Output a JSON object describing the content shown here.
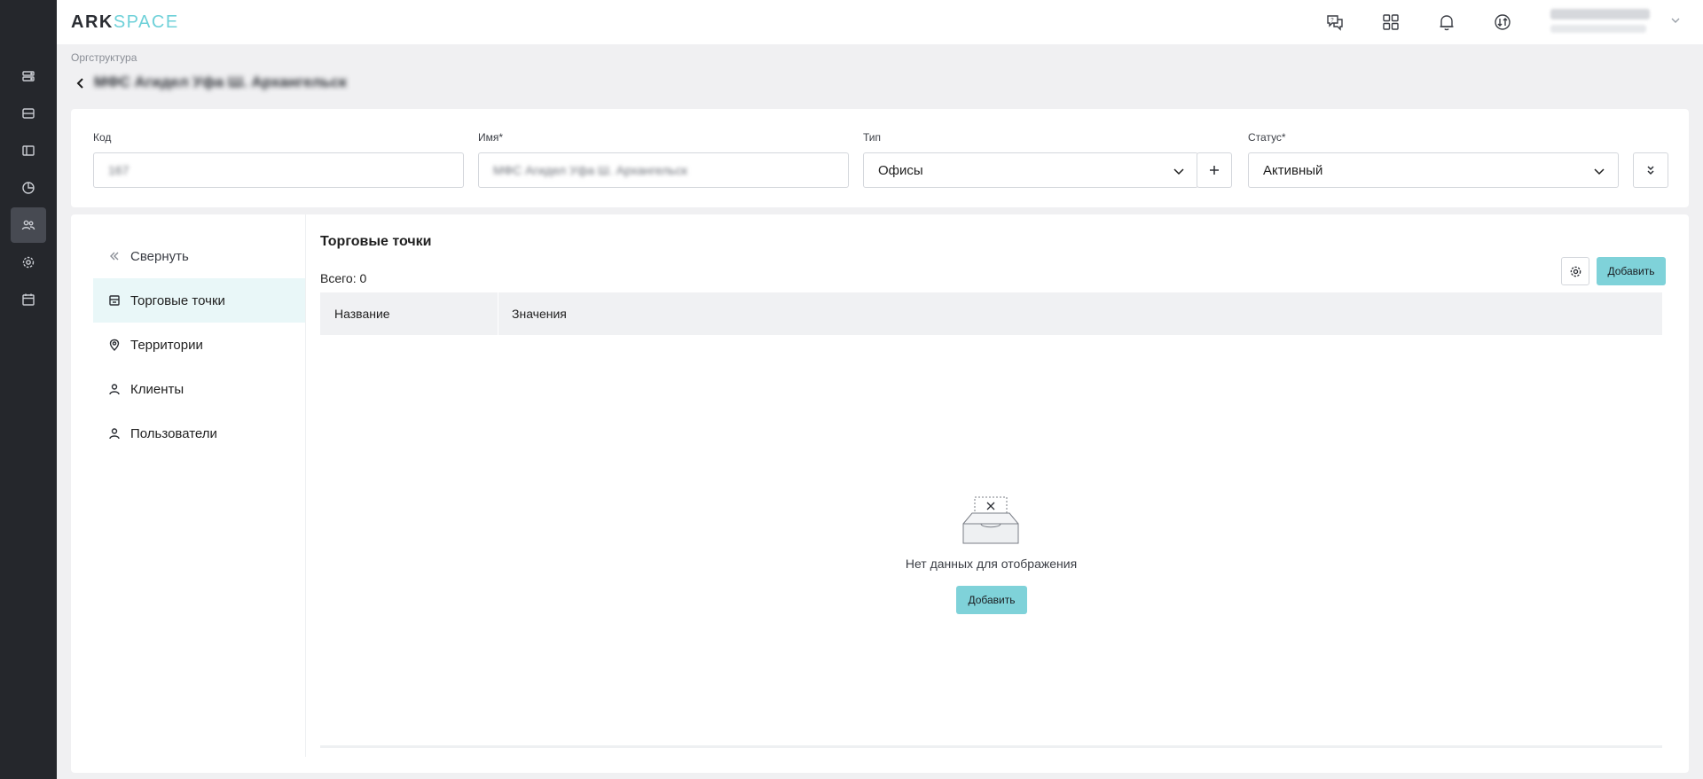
{
  "app": {
    "logo_ark": "ARK",
    "logo_space": "SPACE"
  },
  "header": {
    "icons": [
      "support-chat-icon",
      "apps-grid-icon",
      "notifications-bell-icon",
      "sync-icon"
    ],
    "user": {
      "name": "",
      "role": ""
    }
  },
  "sidebar": {
    "items": [
      {
        "icon": "server-list-icon"
      },
      {
        "icon": "database-icon"
      },
      {
        "icon": "panel-icon"
      },
      {
        "icon": "pie-chart-icon"
      },
      {
        "icon": "users-icon",
        "active": true
      },
      {
        "icon": "settings-icon"
      },
      {
        "icon": "calendar-icon"
      }
    ]
  },
  "breadcrumb": "Оргструктура",
  "page": {
    "title": "МФС Агидел Уфа Ш. Архангельск"
  },
  "form": {
    "code": {
      "label": "Код",
      "value": "167"
    },
    "name": {
      "label": "Имя*",
      "value": "МФС Агидел Уфа Ш. Архангельск"
    },
    "type": {
      "label": "Тип",
      "value": "Офисы"
    },
    "status": {
      "label": "Статус*",
      "value": "Активный"
    }
  },
  "menu": {
    "collapse": "Свернуть",
    "items": [
      {
        "label": "Торговые точки",
        "icon": "store-icon",
        "active": true
      },
      {
        "label": "Территории",
        "icon": "map-pin-icon"
      },
      {
        "label": "Клиенты",
        "icon": "person-icon"
      },
      {
        "label": "Пользователи",
        "icon": "person-icon"
      }
    ]
  },
  "section": {
    "title": "Торговые точки",
    "total": "Всего: 0",
    "add_label": "Добавить",
    "columns": [
      "Название",
      "Значения"
    ],
    "empty_text": "Нет данных для отображения",
    "empty_add_label": "Добавить"
  },
  "colors": {
    "accent": "#7fd2d9",
    "sidebar_bg": "#25272c",
    "active_menu_bg": "#e9f7f8"
  }
}
